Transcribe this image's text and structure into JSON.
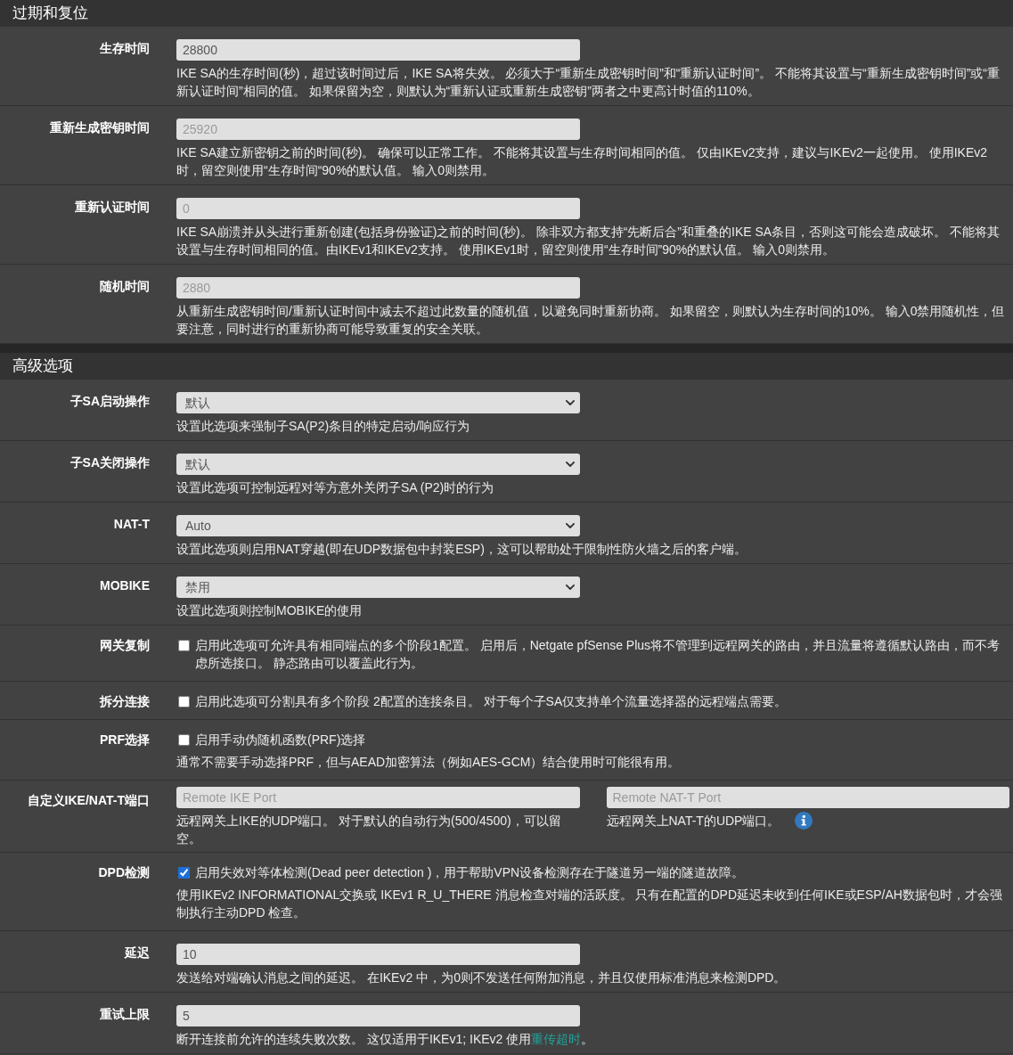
{
  "sections": [
    {
      "title": "过期和复位",
      "rows": [
        {
          "kind": "input",
          "label": "生存时间",
          "fields": [
            {
              "value": "28800",
              "help": "IKE SA的生存时间(秒)，超过该时间过后，IKE SA将失效。 必须大于“重新生成密钥时间”和“重新认证时间”。 不能将其设置与“重新生成密钥时间”或“重新认证时间”相同的值。 如果保留为空，则默认为“重新认证或重新生成密钥”两者之中更高计时值的110%。"
            }
          ]
        },
        {
          "kind": "input",
          "label": "重新生成密钥时间",
          "fields": [
            {
              "placeholder": "25920",
              "help": "IKE SA建立新密钥之前的时间(秒)。 确保可以正常工作。 不能将其设置与生存时间相同的值。 仅由IKEv2支持，建议与IKEv2一起使用。 使用IKEv2时，留空则使用“生存时间“90%的默认值。 输入0则禁用。"
            }
          ]
        },
        {
          "kind": "input",
          "label": "重新认证时间",
          "fields": [
            {
              "placeholder": "0",
              "help": "IKE SA崩溃并从头进行重新创建(包括身份验证)之前的时间(秒)。 除非双方都支持“先断后合”和重叠的IKE SA条目，否则这可能会造成破坏。 不能将其设置与生存时间相同的值。由IKEv1和IKEv2支持。 使用IKEv1时，留空则使用“生存时间”90%的默认值。 输入0则禁用。"
            }
          ]
        },
        {
          "kind": "input",
          "label": "随机时间",
          "fields": [
            {
              "placeholder": "2880",
              "help": "从重新生成密钥时间/重新认证时间中减去不超过此数量的随机值，以避免同时重新协商。 如果留空，则默认为生存时间的10%。 输入0禁用随机性，但要注意，同时进行的重新协商可能导致重复的安全关联。"
            }
          ]
        }
      ]
    },
    {
      "title": "高级选项",
      "rows": [
        {
          "kind": "select",
          "label": "子SA启动操作",
          "fields": [
            {
              "value": "默认",
              "help": "设置此选项来强制子SA(P2)条目的特定启动/响应行为"
            }
          ]
        },
        {
          "kind": "select",
          "label": "子SA关闭操作",
          "fields": [
            {
              "value": "默认",
              "help": "设置此选项可控制远程对等方意外关闭子SA (P2)时的行为"
            }
          ]
        },
        {
          "kind": "select",
          "label": "NAT-T",
          "fields": [
            {
              "value": "Auto",
              "help": "设置此选项则启用NAT穿越(即在UDP数据包中封装ESP)，这可以帮助处于限制性防火墙之后的客户端。"
            }
          ]
        },
        {
          "kind": "select",
          "label": "MOBIKE",
          "fields": [
            {
              "value": "禁用",
              "help": "设置此选项则控制MOBIKE的使用"
            }
          ]
        },
        {
          "kind": "checkbox",
          "label": "网关复制",
          "checkbox": {
            "checked": false,
            "text": "启用此选项可允许具有相同端点的多个阶段1配置。 启用后，Netgate pfSense Plus将不管理到远程网关的路由，并且流量将遵循默认路由，而不考虑所选接口。 静态路由可以覆盖此行为。"
          }
        },
        {
          "kind": "checkbox",
          "label": "拆分连接",
          "checkbox": {
            "checked": false,
            "text": "启用此选项可分割具有多个阶段 2配置的连接条目。 对于每个子SA仅支持单个流量选择器的远程端点需要。"
          }
        },
        {
          "kind": "checkbox",
          "label": "PRF选择",
          "checkbox": {
            "checked": false,
            "text": "启用手动伪随机函数(PRF)选择"
          },
          "help": "通常不需要手动选择PRF，但与AEAD加密算法（例如AES-GCM）结合使用时可能很有用。"
        },
        {
          "kind": "input",
          "label": "自定义IKE/NAT-T端口",
          "fields": [
            {
              "placeholder": "Remote IKE Port",
              "help": "远程网关上IKE的UDP端口。 对于默认的自动行为(500/4500)，可以留空。"
            },
            {
              "placeholder": "Remote NAT-T Port",
              "help": "远程网关上NAT-T的UDP端口。",
              "info": true
            }
          ]
        },
        {
          "kind": "checkbox",
          "label": "DPD检测",
          "checkbox": {
            "checked": true,
            "text": "启用失效对等体检测(Dead peer detection )，用于帮助VPN设备检测存在于隧道另一端的隧道故障。"
          },
          "help": "使用IKEv2 INFORMATIONAL交换或 IKEv1 R_U_THERE 消息检查对端的活跃度。 只有在配置的DPD延迟未收到任何IKE或ESP/AH数据包时，才会强制执行主动DPD 检查。"
        },
        {
          "kind": "input",
          "label": "延迟",
          "fields": [
            {
              "value": "10",
              "help": "发送给对端确认消息之间的延迟。 在IKEv2 中，为0则不发送任何附加消息，并且仅使用标准消息来检测DPD。"
            }
          ]
        },
        {
          "kind": "input",
          "label": "重试上限",
          "fields": [
            {
              "value": "5",
              "help": "断开连接前允许的连续失败次数。 这仅适用于IKEv1; IKEv2 使用",
              "help_link": "重传超时",
              "help_end": "。"
            }
          ]
        }
      ]
    }
  ]
}
